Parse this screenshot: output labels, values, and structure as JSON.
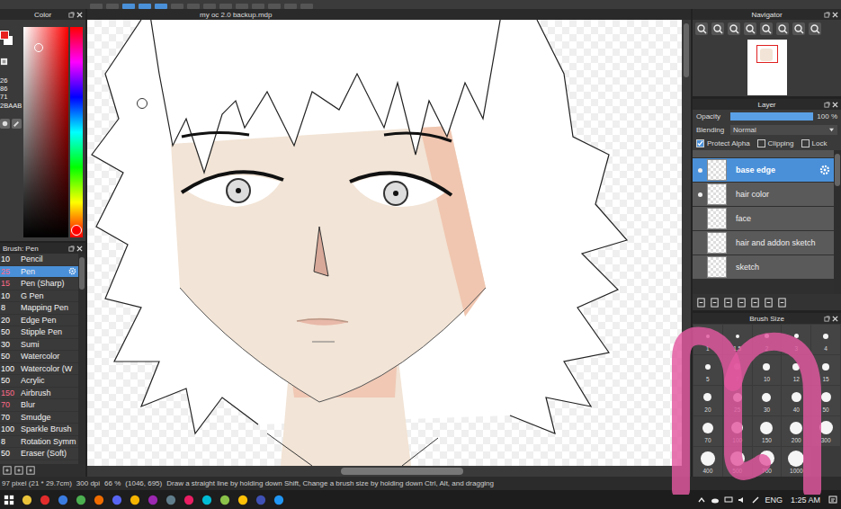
{
  "document": {
    "title": "my oc 2.0 backup.mdp"
  },
  "color_panel": {
    "title": "Color",
    "values": [
      "26",
      "86",
      "71"
    ],
    "hex": "2BAAB"
  },
  "brush_panel": {
    "title": "Brush: Pen",
    "brushes": [
      {
        "size": "10",
        "name": "Pencil",
        "selected": false,
        "color": "#ffffff"
      },
      {
        "size": "25",
        "name": "Pen",
        "selected": true,
        "color": "#ff6b8a"
      },
      {
        "size": "15",
        "name": "Pen (Sharp)",
        "selected": false,
        "color": "#ff6b8a"
      },
      {
        "size": "10",
        "name": "G Pen",
        "selected": false,
        "color": "#ffffff"
      },
      {
        "size": "8",
        "name": "Mapping Pen",
        "selected": false,
        "color": "#ffffff"
      },
      {
        "size": "20",
        "name": "Edge Pen",
        "selected": false,
        "color": "#ffffff"
      },
      {
        "size": "50",
        "name": "Stipple Pen",
        "selected": false,
        "color": "#ffffff"
      },
      {
        "size": "30",
        "name": "Sumi",
        "selected": false,
        "color": "#ffffff"
      },
      {
        "size": "50",
        "name": "Watercolor",
        "selected": false,
        "color": "#ffffff"
      },
      {
        "size": "100",
        "name": "Watercolor (W",
        "selected": false,
        "color": "#ffffff"
      },
      {
        "size": "50",
        "name": "Acrylic",
        "selected": false,
        "color": "#ffffff"
      },
      {
        "size": "150",
        "name": "Airbrush",
        "selected": false,
        "color": "#ff6b8a"
      },
      {
        "size": "70",
        "name": "Blur",
        "selected": false,
        "color": "#ff6b8a"
      },
      {
        "size": "70",
        "name": "Smudge",
        "selected": false,
        "color": "#ffffff"
      },
      {
        "size": "100",
        "name": "Sparkle Brush",
        "selected": false,
        "color": "#ffffff"
      },
      {
        "size": "8",
        "name": "Rotation Symm",
        "selected": false,
        "color": "#ffffff"
      },
      {
        "size": "50",
        "name": "Eraser (Soft)",
        "selected": false,
        "color": "#ffffff"
      }
    ]
  },
  "navigator": {
    "title": "Navigator"
  },
  "layer_panel": {
    "title": "Layer",
    "opacity_label": "Opacity",
    "opacity": "100 %",
    "opacity_level": 1,
    "blending_label": "Blending",
    "blending": "Normal",
    "options": [
      {
        "label": "Protect Alpha",
        "checked": true
      },
      {
        "label": "Clipping",
        "checked": false
      },
      {
        "label": "Lock",
        "checked": false
      }
    ],
    "layers": [
      {
        "name": "base edge",
        "visible": true,
        "selected": true
      },
      {
        "name": "hair color",
        "visible": true,
        "selected": false
      },
      {
        "name": "face",
        "visible": false,
        "selected": false
      },
      {
        "name": "hair and addon sketch",
        "visible": false,
        "selected": false
      },
      {
        "name": "sketch",
        "visible": false,
        "selected": false
      }
    ]
  },
  "brush_size_panel": {
    "title": "Brush Size",
    "sizes": [
      "1",
      "1.5",
      "2",
      "3",
      "4",
      "5",
      "7",
      "10",
      "12",
      "15",
      "20",
      "25",
      "30",
      "40",
      "50",
      "70",
      "100",
      "150",
      "200",
      "300",
      "400",
      "500",
      "700",
      "1000"
    ]
  },
  "status_bar": {
    "size": "97 pixel (21 * 29.7cm)",
    "dpi": "300 dpi",
    "zoom": "66 %",
    "cursor": "(1046, 695)",
    "hint": "Draw a straight line by holding down Shift, Change a brush size by holding down Ctrl, Alt, and dragging"
  },
  "taskbar": {
    "language": "ENG",
    "time": "1:25 AM"
  }
}
